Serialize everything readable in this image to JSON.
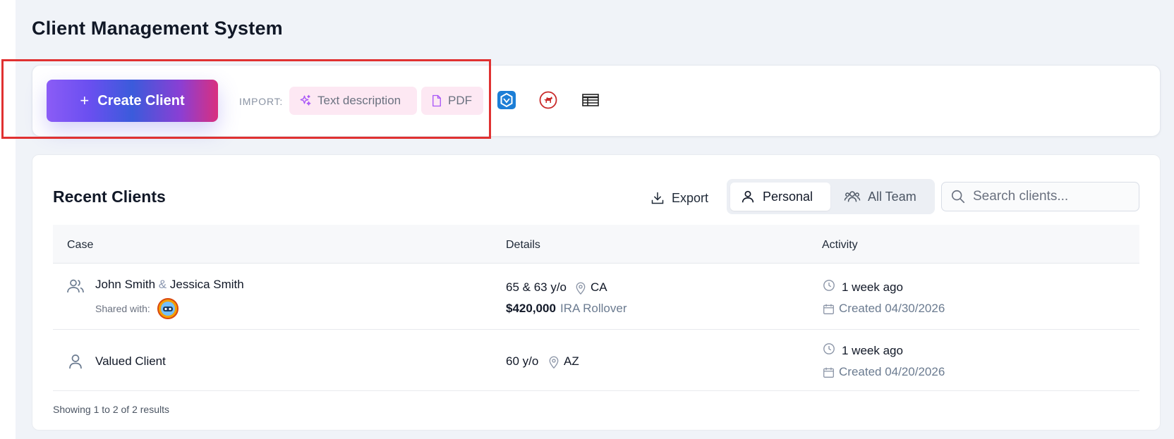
{
  "page": {
    "title": "Client Management System"
  },
  "toolbar": {
    "create_label": "Create Client",
    "import_label": "IMPORT:",
    "import_text_label": "Text description",
    "import_pdf_label": "PDF"
  },
  "clients": {
    "title": "Recent Clients",
    "export_label": "Export",
    "toggle_personal": "Personal",
    "toggle_team": "All Team",
    "search_placeholder": "Search clients...",
    "columns": [
      "Case",
      "Details",
      "Activity"
    ],
    "rows": [
      {
        "name_primary": "John Smith",
        "amp": "&",
        "name_secondary": "Jessica Smith",
        "shared_label": "Shared with:",
        "ages": "65 & 63 y/o",
        "state": "CA",
        "amount": "$420,000",
        "product": "IRA Rollover",
        "last_activity": "1 week ago",
        "created": "Created 04/30/2026"
      },
      {
        "name_primary": "Valued Client",
        "ages": "60 y/o",
        "state": "AZ",
        "last_activity": "1 week ago",
        "created": "Created 04/20/2026"
      }
    ],
    "footer": "Showing 1 to 2 of 2 results"
  },
  "colors": {
    "highlight": "#e03131",
    "gradient_start": "#8b5cf6",
    "gradient_mid": "#3b5bdb",
    "gradient_end": "#d92f7f",
    "chip_bg": "#fde8f3"
  },
  "icons": [
    "plus-icon",
    "sparkle-icon",
    "file-icon",
    "blue-hexagon-icon",
    "red-dog-icon",
    "table-icon",
    "download-icon",
    "user-icon",
    "users-icon",
    "search-icon",
    "pin-icon",
    "clock-icon",
    "calendar-icon"
  ]
}
